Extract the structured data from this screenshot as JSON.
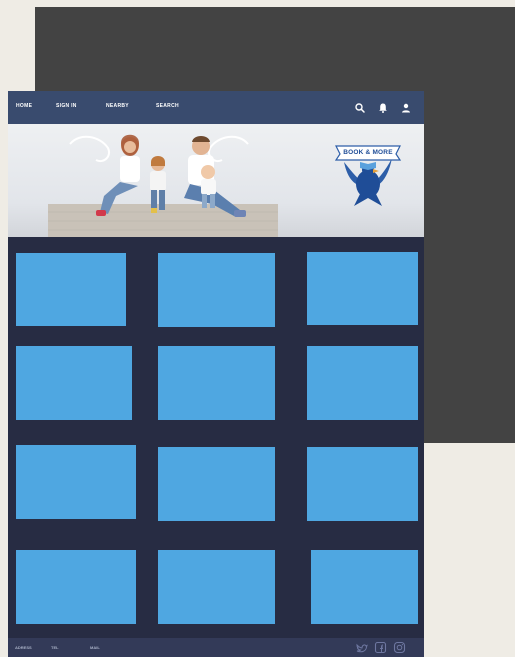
{
  "nav": {
    "links": [
      "HOME",
      "SIGN IN",
      "NEARBY",
      "SEARCH"
    ],
    "icons": [
      "search-icon",
      "bell-icon",
      "user-icon"
    ]
  },
  "brand": {
    "logo_text": "BOOK & MORE"
  },
  "hero": {
    "image": "family-photo"
  },
  "grid": {
    "tile_count": 12,
    "tile_color": "#4fa7e1"
  },
  "footer": {
    "address_label": "ADRESS",
    "tel_label": "TEL",
    "mail_label": "MAIL",
    "social_icons": [
      "twitter-icon",
      "facebook-icon",
      "instagram-icon"
    ]
  },
  "colors": {
    "background": "#efece5",
    "back_panel": "#434343",
    "nav_bar": "#394b6e",
    "page_body": "#272c43",
    "footer": "#333a58",
    "accent": "#4fa7e1"
  }
}
